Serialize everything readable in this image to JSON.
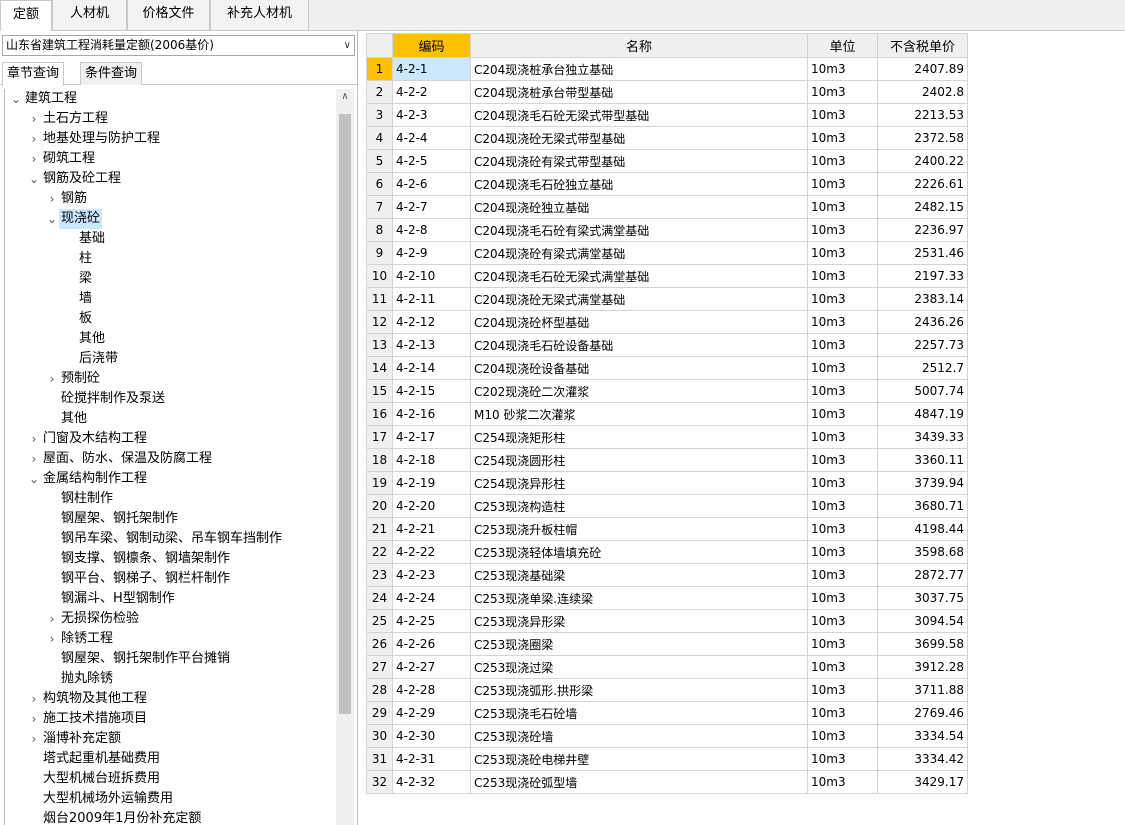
{
  "top_tabs": [
    "定额",
    "人材机",
    "价格文件",
    "补充人材机"
  ],
  "left": {
    "combo_value": "山东省建筑工程消耗量定额(2006基价)",
    "sub_tabs": [
      "章节查询",
      "条件查询"
    ],
    "tree": [
      {
        "label": "建筑工程",
        "level": 0,
        "toggle": "v"
      },
      {
        "label": "土石方工程",
        "level": 1,
        "toggle": ">"
      },
      {
        "label": "地基处理与防护工程",
        "level": 1,
        "toggle": ">"
      },
      {
        "label": "砌筑工程",
        "level": 1,
        "toggle": ">"
      },
      {
        "label": "钢筋及砼工程",
        "level": 1,
        "toggle": "v"
      },
      {
        "label": "钢筋",
        "level": 2,
        "toggle": ">"
      },
      {
        "label": "现浇砼",
        "level": 2,
        "toggle": "v",
        "selected": true
      },
      {
        "label": "基础",
        "level": 3,
        "toggle": ""
      },
      {
        "label": "柱",
        "level": 3,
        "toggle": ""
      },
      {
        "label": "梁",
        "level": 3,
        "toggle": ""
      },
      {
        "label": "墙",
        "level": 3,
        "toggle": ""
      },
      {
        "label": "板",
        "level": 3,
        "toggle": ""
      },
      {
        "label": "其他",
        "level": 3,
        "toggle": ""
      },
      {
        "label": "后浇带",
        "level": 3,
        "toggle": ""
      },
      {
        "label": "预制砼",
        "level": 2,
        "toggle": ">"
      },
      {
        "label": "砼搅拌制作及泵送",
        "level": 2,
        "toggle": ""
      },
      {
        "label": "其他",
        "level": 2,
        "toggle": ""
      },
      {
        "label": "门窗及木结构工程",
        "level": 1,
        "toggle": ">"
      },
      {
        "label": "屋面、防水、保温及防腐工程",
        "level": 1,
        "toggle": ">"
      },
      {
        "label": "金属结构制作工程",
        "level": 1,
        "toggle": "v"
      },
      {
        "label": "钢柱制作",
        "level": 2,
        "toggle": ""
      },
      {
        "label": "钢屋架、钢托架制作",
        "level": 2,
        "toggle": ""
      },
      {
        "label": "钢吊车梁、钢制动梁、吊车钢车挡制作",
        "level": 2,
        "toggle": ""
      },
      {
        "label": "钢支撑、钢檩条、钢墙架制作",
        "level": 2,
        "toggle": ""
      },
      {
        "label": "钢平台、钢梯子、钢栏杆制作",
        "level": 2,
        "toggle": ""
      },
      {
        "label": "钢漏斗、H型钢制作",
        "level": 2,
        "toggle": ""
      },
      {
        "label": "无损探伤检验",
        "level": 2,
        "toggle": ">"
      },
      {
        "label": "除锈工程",
        "level": 2,
        "toggle": ">"
      },
      {
        "label": "钢屋架、钢托架制作平台摊销",
        "level": 2,
        "toggle": ""
      },
      {
        "label": "抛丸除锈",
        "level": 2,
        "toggle": ""
      },
      {
        "label": "构筑物及其他工程",
        "level": 1,
        "toggle": ">"
      },
      {
        "label": "施工技术措施项目",
        "level": 1,
        "toggle": ">"
      },
      {
        "label": "淄博补充定额",
        "level": 1,
        "toggle": ">"
      },
      {
        "label": "塔式起重机基础费用",
        "level": 1,
        "toggle": ""
      },
      {
        "label": "大型机械台班拆费用",
        "level": 1,
        "toggle": ""
      },
      {
        "label": "大型机械场外运输费用",
        "level": 1,
        "toggle": ""
      },
      {
        "label": "烟台2009年1月份补充定额",
        "level": 1,
        "toggle": ""
      }
    ]
  },
  "grid": {
    "headers": [
      "编码",
      "名称",
      "单位",
      "不含税单价"
    ],
    "rows": [
      [
        "1",
        "4-2-1",
        "C204现浇桩承台独立基础",
        "10m3",
        "2407.89"
      ],
      [
        "2",
        "4-2-2",
        "C204现浇桩承台带型基础",
        "10m3",
        "2402.8"
      ],
      [
        "3",
        "4-2-3",
        "C204现浇毛石砼无梁式带型基础",
        "10m3",
        "2213.53"
      ],
      [
        "4",
        "4-2-4",
        "C204现浇砼无梁式带型基础",
        "10m3",
        "2372.58"
      ],
      [
        "5",
        "4-2-5",
        "C204现浇砼有梁式带型基础",
        "10m3",
        "2400.22"
      ],
      [
        "6",
        "4-2-6",
        "C204现浇毛石砼独立基础",
        "10m3",
        "2226.61"
      ],
      [
        "7",
        "4-2-7",
        "C204现浇砼独立基础",
        "10m3",
        "2482.15"
      ],
      [
        "8",
        "4-2-8",
        "C204现浇毛石砼有梁式满堂基础",
        "10m3",
        "2236.97"
      ],
      [
        "9",
        "4-2-9",
        "C204现浇砼有梁式满堂基础",
        "10m3",
        "2531.46"
      ],
      [
        "10",
        "4-2-10",
        "C204现浇毛石砼无梁式满堂基础",
        "10m3",
        "2197.33"
      ],
      [
        "11",
        "4-2-11",
        "C204现浇砼无梁式满堂基础",
        "10m3",
        "2383.14"
      ],
      [
        "12",
        "4-2-12",
        "C204现浇砼杯型基础",
        "10m3",
        "2436.26"
      ],
      [
        "13",
        "4-2-13",
        "C204现浇毛石砼设备基础",
        "10m3",
        "2257.73"
      ],
      [
        "14",
        "4-2-14",
        "C204现浇砼设备基础",
        "10m3",
        "2512.7"
      ],
      [
        "15",
        "4-2-15",
        "C202现浇砼二次灌浆",
        "10m3",
        "5007.74"
      ],
      [
        "16",
        "4-2-16",
        "M10 砂浆二次灌浆",
        "10m3",
        "4847.19"
      ],
      [
        "17",
        "4-2-17",
        "C254现浇矩形柱",
        "10m3",
        "3439.33"
      ],
      [
        "18",
        "4-2-18",
        "C254现浇圆形柱",
        "10m3",
        "3360.11"
      ],
      [
        "19",
        "4-2-19",
        "C254现浇异形柱",
        "10m3",
        "3739.94"
      ],
      [
        "20",
        "4-2-20",
        "C253现浇构造柱",
        "10m3",
        "3680.71"
      ],
      [
        "21",
        "4-2-21",
        "C253现浇升板柱帽",
        "10m3",
        "4198.44"
      ],
      [
        "22",
        "4-2-22",
        "C253现浇轻体墙填充砼",
        "10m3",
        "3598.68"
      ],
      [
        "23",
        "4-2-23",
        "C253现浇基础梁",
        "10m3",
        "2872.77"
      ],
      [
        "24",
        "4-2-24",
        "C253现浇单梁.连续梁",
        "10m3",
        "3037.75"
      ],
      [
        "25",
        "4-2-25",
        "C253现浇异形梁",
        "10m3",
        "3094.54"
      ],
      [
        "26",
        "4-2-26",
        "C253现浇圈梁",
        "10m3",
        "3699.58"
      ],
      [
        "27",
        "4-2-27",
        "C253现浇过梁",
        "10m3",
        "3912.28"
      ],
      [
        "28",
        "4-2-28",
        "C253现浇弧形.拱形梁",
        "10m3",
        "3711.88"
      ],
      [
        "29",
        "4-2-29",
        "C253现浇毛石砼墙",
        "10m3",
        "2769.46"
      ],
      [
        "30",
        "4-2-30",
        "C253现浇砼墙",
        "10m3",
        "3334.54"
      ],
      [
        "31",
        "4-2-31",
        "C253现浇砼电梯井壁",
        "10m3",
        "3334.42"
      ],
      [
        "32",
        "4-2-32",
        "C253现浇砼弧型墙",
        "10m3",
        "3429.17"
      ]
    ]
  },
  "colors": {
    "header_highlight": "#ffc000",
    "selection": "#cce8ff"
  }
}
